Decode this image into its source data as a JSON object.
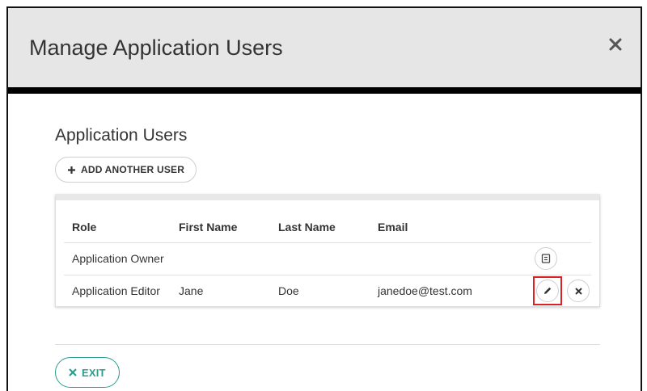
{
  "modal": {
    "title": "Manage Application Users",
    "close_icon": "close-icon"
  },
  "section": {
    "title": "Application Users",
    "add_button_label": "ADD ANOTHER USER",
    "add_icon": "plus-icon"
  },
  "table": {
    "columns": [
      "Role",
      "First Name",
      "Last Name",
      "Email"
    ],
    "rows": [
      {
        "role": "Application Owner",
        "first_name": "",
        "last_name": "",
        "email": "",
        "actions": [
          "contact-card-icon"
        ]
      },
      {
        "role": "Application Editor",
        "first_name": "Jane",
        "last_name": "Doe",
        "email": "janedoe@test.com",
        "actions": [
          "pencil-icon",
          "close-icon"
        ]
      }
    ]
  },
  "footer": {
    "exit_label": "EXIT",
    "exit_icon": "close-icon"
  },
  "colors": {
    "accent": "#2a9d8f",
    "highlight": "#e02020",
    "header_bg": "#e6e6e6"
  }
}
